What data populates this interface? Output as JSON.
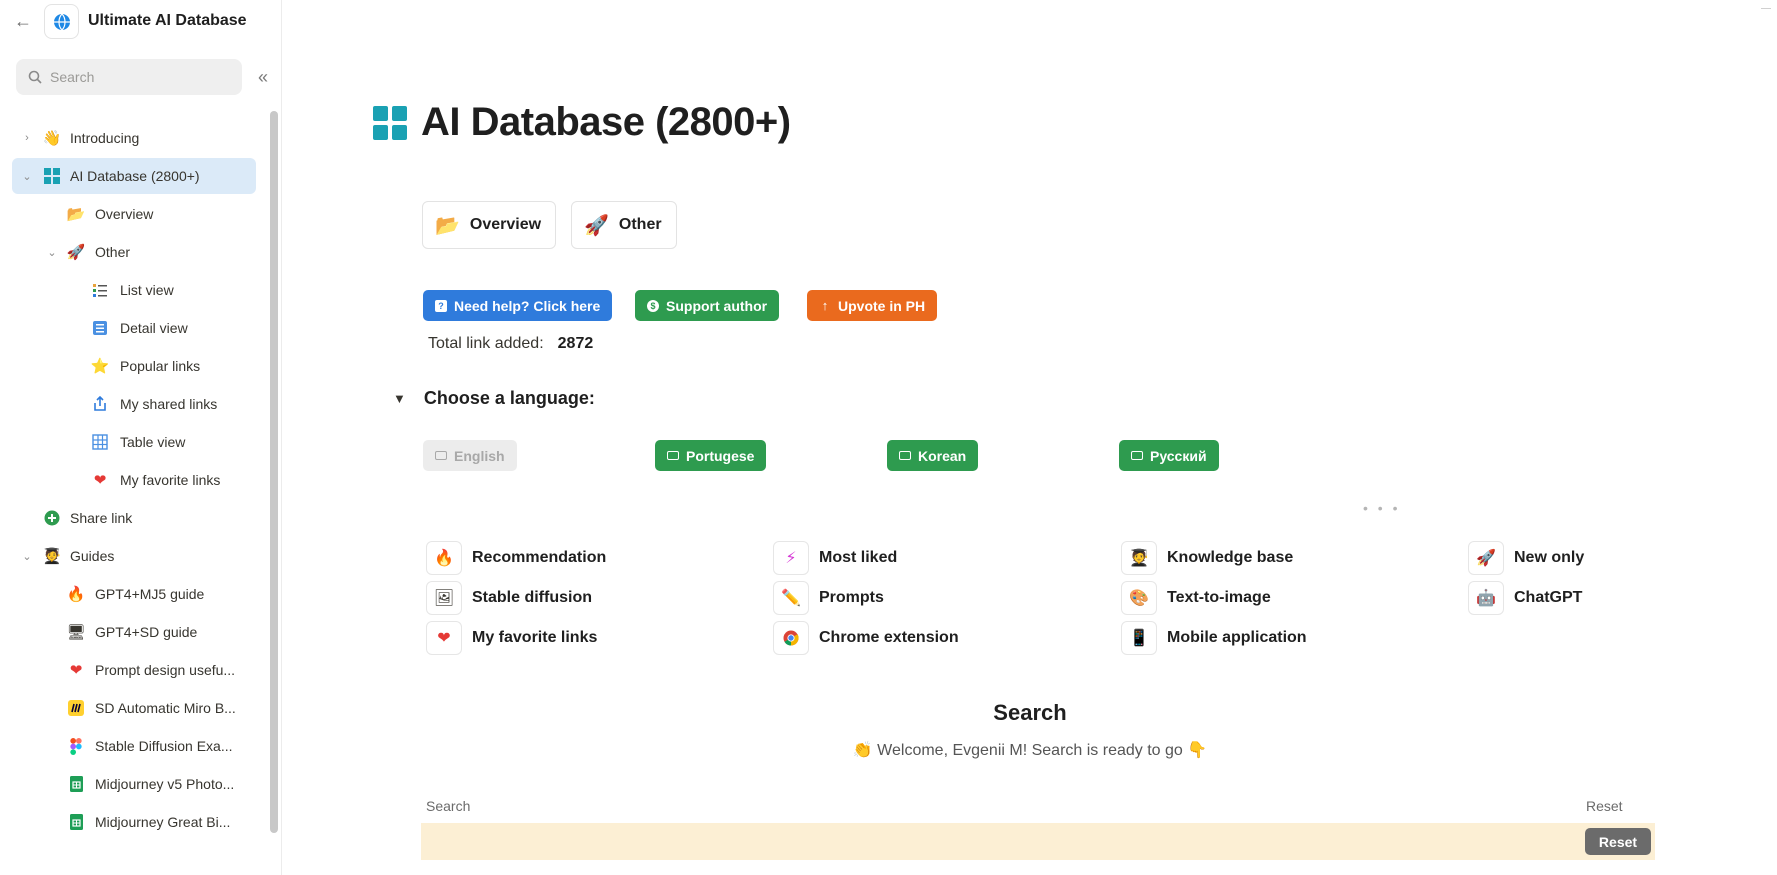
{
  "app": {
    "title": "Ultimate AI Database"
  },
  "sidebar": {
    "search_placeholder": "Search",
    "items": [
      {
        "label": "Introducing",
        "icon": "👋"
      },
      {
        "label": "AI Database (2800+)",
        "icon": "grid-icon"
      },
      {
        "label": "Overview",
        "icon": "📂"
      },
      {
        "label": "Other",
        "icon": "🚀"
      },
      {
        "label": "List view",
        "icon": "list-icon"
      },
      {
        "label": "Detail view",
        "icon": "detail-icon"
      },
      {
        "label": "Popular links",
        "icon": "⭐"
      },
      {
        "label": "My shared links",
        "icon": "share-icon"
      },
      {
        "label": "Table view",
        "icon": "table-icon"
      },
      {
        "label": "My favorite links",
        "icon": "❤️"
      },
      {
        "label": "Share link",
        "icon": "plus-circle-icon"
      },
      {
        "label": "Guides",
        "icon": "🧑‍🎓"
      },
      {
        "label": "GPT4+MJ5 guide",
        "icon": "🔥"
      },
      {
        "label": "GPT4+SD guide",
        "icon": "🖥️"
      },
      {
        "label": "Prompt design usefu...",
        "icon": "❤️"
      },
      {
        "label": "SD Automatic Miro B...",
        "icon": "miro-icon"
      },
      {
        "label": "Stable Diffusion Exa...",
        "icon": "figma-icon"
      },
      {
        "label": "Midjourney v5 Photo...",
        "icon": "sheets-icon"
      },
      {
        "label": "Midjourney Great Bi...",
        "icon": "sheets-icon"
      }
    ]
  },
  "main": {
    "page_title": "AI Database (2800+)",
    "links": [
      {
        "label": "Overview",
        "icon": "📂"
      },
      {
        "label": "Other",
        "icon": "🚀"
      }
    ],
    "pills": [
      {
        "label": "Need help? Click here",
        "color": "#2f7bdc",
        "icon": "?"
      },
      {
        "label": "Support author",
        "color": "#2e9b4f",
        "icon": "$"
      },
      {
        "label": "Upvote in PH",
        "color": "#ea6a1e",
        "icon": "↑"
      }
    ],
    "total": {
      "label": "Total link added:",
      "value": "2872"
    },
    "language_toggle": "Choose a language:",
    "languages": [
      "English",
      "Portugese",
      "Korean",
      "Русский"
    ],
    "categories": [
      {
        "label": "Recommendation",
        "icon": "🔥"
      },
      {
        "label": "Most liked",
        "icon": "⚡"
      },
      {
        "label": "Knowledge base",
        "icon": "🧑‍🎓"
      },
      {
        "label": "New only",
        "icon": "🚀"
      },
      {
        "label": "Stable diffusion",
        "icon": "🖼️"
      },
      {
        "label": "Prompts",
        "icon": "✏️"
      },
      {
        "label": "Text-to-image",
        "icon": "🎨"
      },
      {
        "label": "ChatGPT",
        "icon": "🤖"
      },
      {
        "label": "My favorite links",
        "icon": "❤️"
      },
      {
        "label": "Chrome extension",
        "icon": "chrome-icon"
      },
      {
        "label": "Mobile application",
        "icon": "📱"
      }
    ],
    "search_title": "Search",
    "welcome": "👏 Welcome, Evgenii M! Search is ready to go 👇",
    "search_label": "Search",
    "reset_label": "Reset",
    "reset_button": "Reset"
  }
}
